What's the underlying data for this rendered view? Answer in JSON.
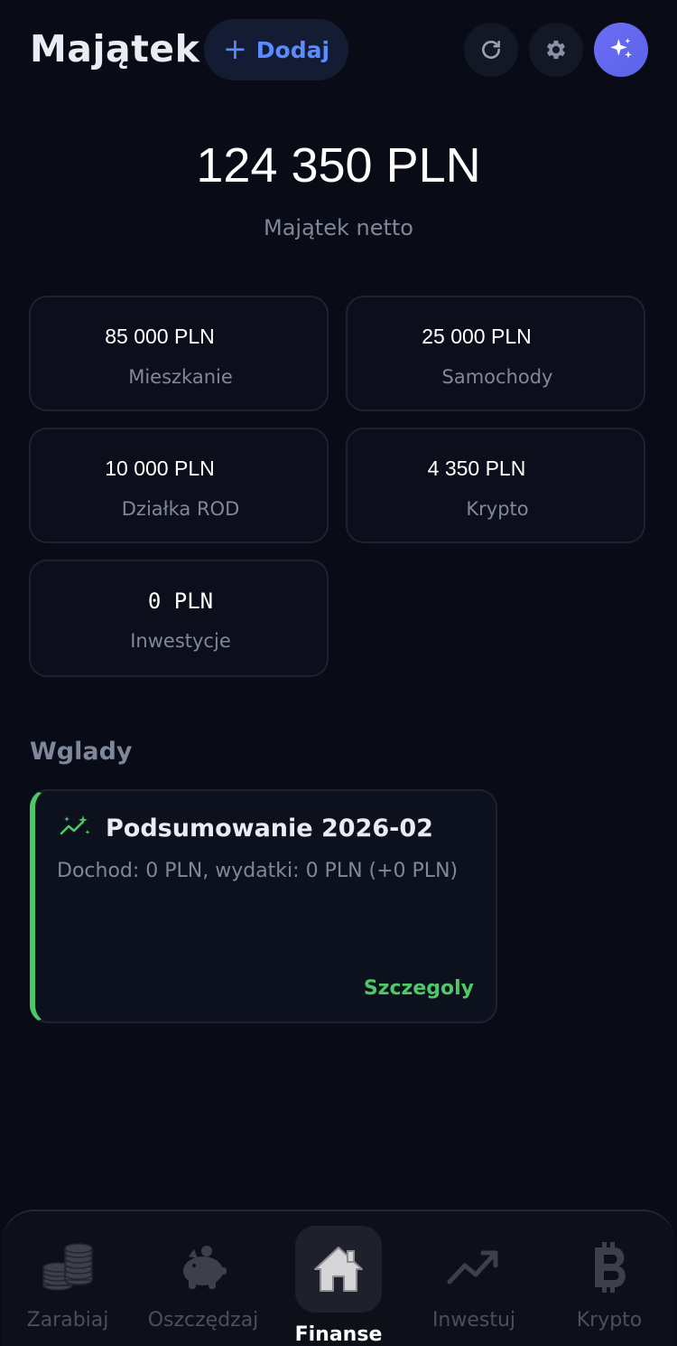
{
  "header": {
    "title": "Majątek",
    "add_label": "Dodaj",
    "add_icon": "plus-icon",
    "actions": [
      "refresh-icon",
      "gear-icon",
      "sparkles-icon"
    ]
  },
  "summary": {
    "net_value": "124 350 PLN",
    "net_label": "Majątek netto"
  },
  "assets": [
    {
      "value": "85 000 PLN",
      "label": "Mieszkanie"
    },
    {
      "value": "25 000 PLN",
      "label": "Samochody"
    },
    {
      "value": "10 000 PLN",
      "label": "Działka ROD"
    },
    {
      "value": "4 350 PLN",
      "label": "Krypto"
    },
    {
      "value": "0 PLN",
      "label": "Inwestycje"
    }
  ],
  "insights": {
    "section_title": "Wglady",
    "items": [
      {
        "title": "Podsumowanie 2026-02",
        "text": "Dochod: 0 PLN, wydatki: 0 PLN (+0 PLN)",
        "link": "Szczegoly",
        "icon": "trend-sparkle-icon",
        "accent": "#4ec866"
      }
    ]
  },
  "nav": {
    "active": "Finanse",
    "items": [
      {
        "label": "Zarabiaj",
        "icon": "coins-icon"
      },
      {
        "label": "Oszczędzaj",
        "icon": "piggy-bank-icon"
      },
      {
        "label": "Finanse",
        "icon": "home-icon"
      },
      {
        "label": "Inwestuj",
        "icon": "trending-up-icon"
      },
      {
        "label": "Krypto",
        "icon": "bitcoin-icon"
      }
    ]
  },
  "colors": {
    "background": "#090b16",
    "accent_blue": "#5b8cff",
    "accent_green": "#4ec866",
    "accent_purple": "#6d6cf5",
    "muted_text": "#7f879a"
  }
}
